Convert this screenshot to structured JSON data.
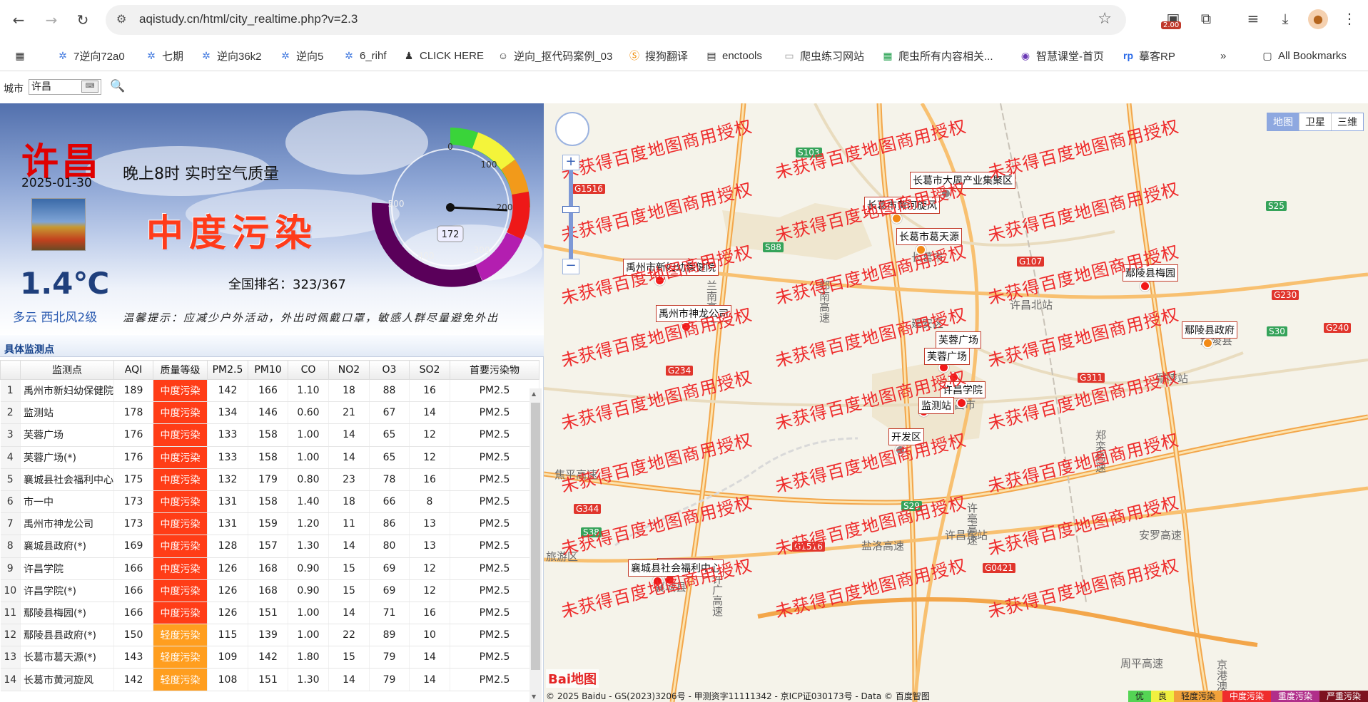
{
  "browser": {
    "url": "aqistudy.cn/html/city_realtime.php?v=2.3",
    "ext_badge": "2.00",
    "bookmarks": [
      {
        "label": "7逆向72a0",
        "icon": "snowflake-icon"
      },
      {
        "label": "七期",
        "icon": "snowflake-icon"
      },
      {
        "label": "逆向36k2",
        "icon": "snowflake-icon"
      },
      {
        "label": "逆向5",
        "icon": "snowflake-icon"
      },
      {
        "label": "6_rihf",
        "icon": "snowflake-icon"
      },
      {
        "label": "CLICK HERE",
        "icon": "person-icon"
      },
      {
        "label": "逆向_抠代码案例_03",
        "icon": "ghost-icon"
      },
      {
        "label": "搜狗翻译",
        "icon": "sogou-icon"
      },
      {
        "label": "enctools",
        "icon": "calendar-icon"
      },
      {
        "label": "爬虫练习网站",
        "icon": "page-icon"
      },
      {
        "label": "爬虫所有内容相关...",
        "icon": "sheet-icon"
      },
      {
        "label": "智慧课堂-首页",
        "icon": "eye-icon"
      },
      {
        "label": "摹客RP",
        "icon": "rp-icon"
      }
    ],
    "all_bookmarks": "All Bookmarks"
  },
  "search": {
    "label": "城市",
    "value": "许昌"
  },
  "summary": {
    "city": "许昌",
    "date": "2025-01-30",
    "temperature": "1.4℃",
    "weather": "多云 西北风2级",
    "title": "晚上8时 实时空气质量",
    "grade": "中度污染",
    "rank": "全国排名：323/367",
    "tip": "温馨提示：应减少户外活动，外出时佩戴口罩，敏感人群尽量避免外出",
    "aqi": "172",
    "gauge_ticks": [
      "0",
      "100",
      "200",
      "300",
      "400",
      "500"
    ]
  },
  "monitor": {
    "header": "具体监测点",
    "columns": [
      "",
      "监测点",
      "AQI",
      "质量等级",
      "PM2.5",
      "PM10",
      "CO",
      "NO2",
      "O3",
      "SO2",
      "首要污染物"
    ],
    "rows": [
      [
        "1",
        "禹州市新妇幼保健院",
        "189",
        "中度污染",
        "142",
        "166",
        "1.10",
        "18",
        "88",
        "16",
        "PM2.5"
      ],
      [
        "2",
        "监测站",
        "178",
        "中度污染",
        "134",
        "146",
        "0.60",
        "21",
        "67",
        "14",
        "PM2.5"
      ],
      [
        "3",
        "芙蓉广场",
        "176",
        "中度污染",
        "133",
        "158",
        "1.00",
        "14",
        "65",
        "12",
        "PM2.5"
      ],
      [
        "4",
        "芙蓉广场(*)",
        "176",
        "中度污染",
        "133",
        "158",
        "1.00",
        "14",
        "65",
        "12",
        "PM2.5"
      ],
      [
        "5",
        "襄城县社会福利中心",
        "175",
        "中度污染",
        "132",
        "179",
        "0.80",
        "23",
        "78",
        "16",
        "PM2.5"
      ],
      [
        "6",
        "市一中",
        "173",
        "中度污染",
        "131",
        "158",
        "1.40",
        "18",
        "66",
        "8",
        "PM2.5"
      ],
      [
        "7",
        "禹州市神龙公司",
        "173",
        "中度污染",
        "131",
        "159",
        "1.20",
        "11",
        "86",
        "13",
        "PM2.5"
      ],
      [
        "8",
        "襄城县政府(*)",
        "169",
        "中度污染",
        "128",
        "157",
        "1.30",
        "14",
        "80",
        "13",
        "PM2.5"
      ],
      [
        "9",
        "许昌学院",
        "166",
        "中度污染",
        "126",
        "168",
        "0.90",
        "15",
        "69",
        "12",
        "PM2.5"
      ],
      [
        "10",
        "许昌学院(*)",
        "166",
        "中度污染",
        "126",
        "168",
        "0.90",
        "15",
        "69",
        "12",
        "PM2.5"
      ],
      [
        "11",
        "鄢陵县梅园(*)",
        "166",
        "中度污染",
        "126",
        "151",
        "1.00",
        "14",
        "71",
        "16",
        "PM2.5"
      ],
      [
        "12",
        "鄢陵县县政府(*)",
        "150",
        "轻度污染",
        "115",
        "139",
        "1.00",
        "22",
        "89",
        "10",
        "PM2.5"
      ],
      [
        "13",
        "长葛市葛天源(*)",
        "143",
        "轻度污染",
        "109",
        "142",
        "1.80",
        "15",
        "79",
        "14",
        "PM2.5"
      ],
      [
        "14",
        "长葛市黄河旋风",
        "142",
        "轻度污染",
        "108",
        "151",
        "1.30",
        "14",
        "79",
        "14",
        "PM2.5"
      ]
    ]
  },
  "map": {
    "map_types": [
      "地图",
      "卫星",
      "三维"
    ],
    "watermark": "未获得百度地图商用授权",
    "markers": [
      {
        "label": "长葛市大周产业集聚区"
      },
      {
        "label": "长葛市黄河旋风"
      },
      {
        "label": "长葛市葛天源"
      },
      {
        "label": "禹州市新妇幼保健院"
      },
      {
        "label": "鄢陵县梅园"
      },
      {
        "label": "禹州市神龙公司"
      },
      {
        "label": "鄢陵县政府"
      },
      {
        "label": "芙蓉广场"
      },
      {
        "label": "芙蓉广场"
      },
      {
        "label": "许昌学院"
      },
      {
        "label": "监测站"
      },
      {
        "label": "开发区"
      },
      {
        "label": "襄城县政府"
      },
      {
        "label": "襄城县社会福利中心"
      }
    ],
    "places": [
      "长葛市",
      "许昌北站",
      "建安区",
      "郑南高速",
      "焦平高速",
      "兰南高速",
      "郑栾高速",
      "盐洛高速",
      "安罗高速",
      "许广高速",
      "周平高速",
      "京港澳高速",
      "许亳高速",
      "鄢陵站",
      "许昌市",
      "许昌东站",
      "鄢陵县",
      "旅游区",
      "襄城县"
    ],
    "roads": [
      "G1516",
      "S103",
      "S88",
      "G107",
      "S25",
      "S30",
      "G230",
      "S29",
      "G311",
      "G234",
      "G344",
      "S38",
      "G240",
      "G0421",
      "G1516"
    ],
    "logo": "Bai地图",
    "copyright": "© 2025 Baidu - GS(2023)3206号 - 甲测资字11111342 - 京ICP证030173号 - Data © 百度智图",
    "legend": [
      "优",
      "良",
      "轻度污染",
      "中度污染",
      "重度污染",
      "严重污染"
    ],
    "legend_colors": [
      "#54d454",
      "#f0f040",
      "#f2a23a",
      "#ef2d2d",
      "#b02e8a",
      "#7e1320"
    ]
  }
}
